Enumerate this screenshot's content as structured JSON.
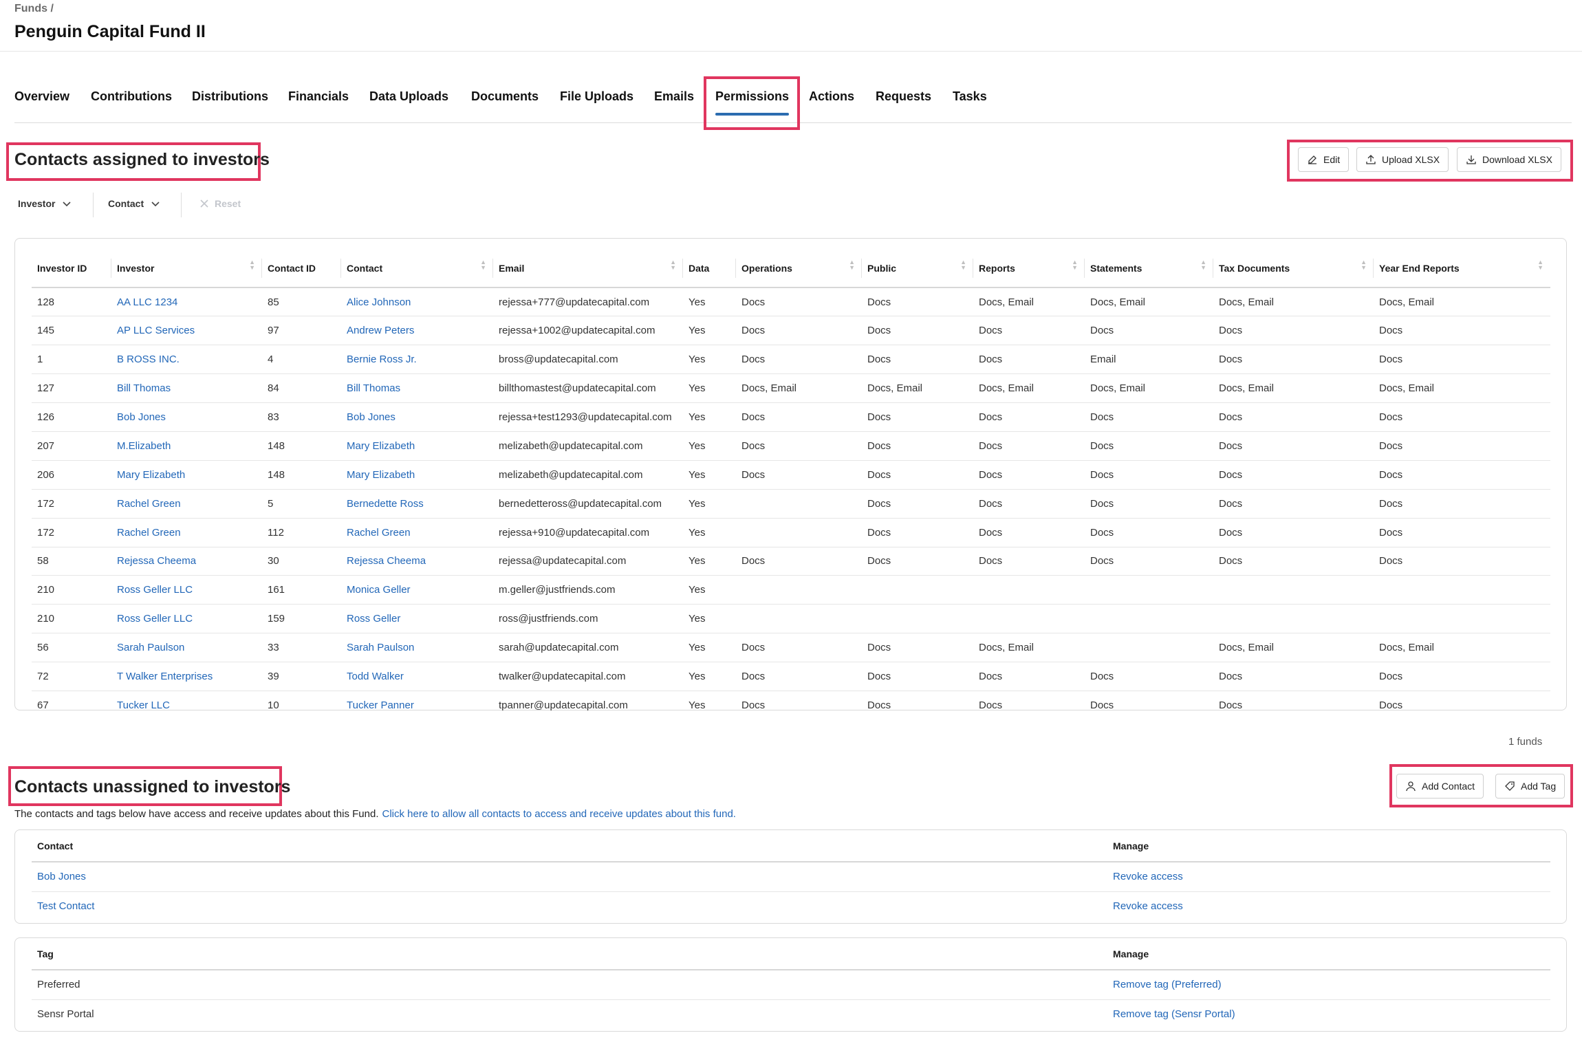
{
  "header": {
    "breadcrumb": "Funds /",
    "title": "Penguin Capital Fund II"
  },
  "tabs": [
    {
      "label": "Overview"
    },
    {
      "label": "Contributions"
    },
    {
      "label": "Distributions"
    },
    {
      "label": "Financials"
    },
    {
      "label": "Data Uploads"
    },
    {
      "label": "Documents"
    },
    {
      "label": "File Uploads"
    },
    {
      "label": "Emails"
    },
    {
      "label": "Permissions",
      "active": true
    },
    {
      "label": "Actions"
    },
    {
      "label": "Requests"
    },
    {
      "label": "Tasks"
    }
  ],
  "assigned": {
    "title": "Contacts assigned to investors",
    "buttons": {
      "edit": "Edit",
      "upload": "Upload XLSX",
      "download": "Download XLSX"
    },
    "filters": {
      "investor": "Investor",
      "contact": "Contact",
      "reset": "Reset"
    },
    "columns": [
      "Investor ID",
      "Investor",
      "Contact ID",
      "Contact",
      "Email",
      "Data",
      "Operations",
      "Public",
      "Reports",
      "Statements",
      "Tax Documents",
      "Year End Reports"
    ],
    "rows": [
      [
        "128",
        "AA LLC 1234",
        "85",
        "Alice Johnson",
        "rejessa+777@updatecapital.com",
        "Yes",
        "Docs",
        "Docs",
        "Docs, Email",
        "Docs, Email",
        "Docs, Email",
        "Docs, Email"
      ],
      [
        "145",
        "AP LLC Services",
        "97",
        "Andrew Peters",
        "rejessa+1002@updatecapital.com",
        "Yes",
        "Docs",
        "Docs",
        "Docs",
        "Docs",
        "Docs",
        "Docs"
      ],
      [
        "1",
        "B ROSS INC.",
        "4",
        "Bernie Ross Jr.",
        "bross@updatecapital.com",
        "Yes",
        "Docs",
        "Docs",
        "Docs",
        "Email",
        "Docs",
        "Docs"
      ],
      [
        "127",
        "Bill Thomas",
        "84",
        "Bill Thomas",
        "billthomastest@updatecapital.com",
        "Yes",
        "Docs, Email",
        "Docs, Email",
        "Docs, Email",
        "Docs, Email",
        "Docs, Email",
        "Docs, Email"
      ],
      [
        "126",
        "Bob Jones",
        "83",
        "Bob Jones",
        "rejessa+test1293@updatecapital.com",
        "Yes",
        "Docs",
        "Docs",
        "Docs",
        "Docs",
        "Docs",
        "Docs"
      ],
      [
        "207",
        "M.Elizabeth",
        "148",
        "Mary Elizabeth",
        "melizabeth@updatecapital.com",
        "Yes",
        "Docs",
        "Docs",
        "Docs",
        "Docs",
        "Docs",
        "Docs"
      ],
      [
        "206",
        "Mary Elizabeth",
        "148",
        "Mary Elizabeth",
        "melizabeth@updatecapital.com",
        "Yes",
        "Docs",
        "Docs",
        "Docs",
        "Docs",
        "Docs",
        "Docs"
      ],
      [
        "172",
        "Rachel Green",
        "5",
        "Bernedette Ross",
        "bernedetteross@updatecapital.com",
        "Yes",
        "",
        "Docs",
        "Docs",
        "Docs",
        "Docs",
        "Docs"
      ],
      [
        "172",
        "Rachel Green",
        "112",
        "Rachel Green",
        "rejessa+910@updatecapital.com",
        "Yes",
        "",
        "Docs",
        "Docs",
        "Docs",
        "Docs",
        "Docs"
      ],
      [
        "58",
        "Rejessa Cheema",
        "30",
        "Rejessa Cheema",
        "rejessa@updatecapital.com",
        "Yes",
        "Docs",
        "Docs",
        "Docs",
        "Docs",
        "Docs",
        "Docs"
      ],
      [
        "210",
        "Ross Geller LLC",
        "161",
        "Monica Geller",
        "m.geller@justfriends.com",
        "Yes",
        "",
        "",
        "",
        "",
        "",
        ""
      ],
      [
        "210",
        "Ross Geller LLC",
        "159",
        "Ross Geller",
        "ross@justfriends.com",
        "Yes",
        "",
        "",
        "",
        "",
        "",
        ""
      ],
      [
        "56",
        "Sarah Paulson",
        "33",
        "Sarah Paulson",
        "sarah@updatecapital.com",
        "Yes",
        "Docs",
        "Docs",
        "Docs, Email",
        "",
        "Docs, Email",
        "Docs, Email"
      ],
      [
        "72",
        "T Walker Enterprises",
        "39",
        "Todd Walker",
        "twalker@updatecapital.com",
        "Yes",
        "Docs",
        "Docs",
        "Docs",
        "Docs",
        "Docs",
        "Docs"
      ],
      [
        "67",
        "Tucker LLC",
        "10",
        "Tucker Panner",
        "tpanner@updatecapital.com",
        "Yes",
        "Docs",
        "Docs",
        "Docs",
        "Docs",
        "Docs",
        "Docs"
      ]
    ],
    "footer": "1 funds"
  },
  "unassigned": {
    "title": "Contacts unassigned to investors",
    "buttons": {
      "add_contact": "Add Contact",
      "add_tag": "Add Tag"
    },
    "description": "The contacts and tags below have access and receive updates about this Fund.",
    "description_link": "Click here to allow all contacts to access and receive updates about this fund.",
    "contacts": {
      "columns": [
        "Contact",
        "Manage"
      ],
      "rows": [
        [
          "Bob Jones",
          "Revoke access"
        ],
        [
          "Test Contact",
          "Revoke access"
        ]
      ]
    },
    "tags": {
      "columns": [
        "Tag",
        "Manage"
      ],
      "rows": [
        [
          "Preferred",
          "Remove tag (Preferred)"
        ],
        [
          "Sensr Portal",
          "Remove tag (Sensr Portal)"
        ]
      ]
    }
  }
}
